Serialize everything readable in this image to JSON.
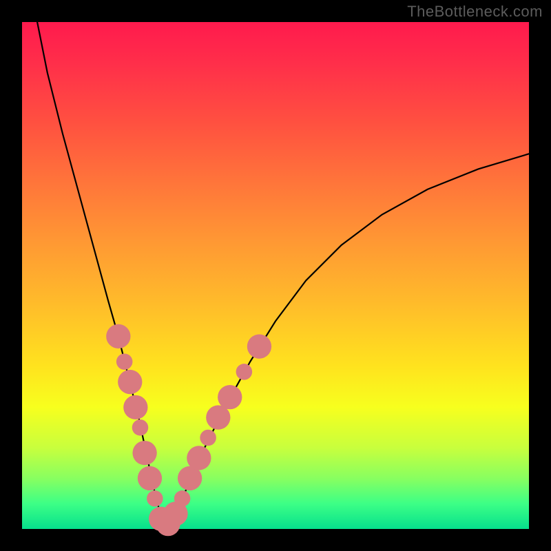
{
  "watermark": "TheBottleneck.com",
  "chart_data": {
    "type": "line",
    "title": "",
    "xlabel": "",
    "ylabel": "",
    "xlim": [
      0,
      100
    ],
    "ylim": [
      0,
      100
    ],
    "grid": false,
    "legend": false,
    "background_gradient": {
      "direction": "vertical",
      "stops": [
        {
          "pos": 0,
          "color": "#ff1a4d"
        },
        {
          "pos": 20,
          "color": "#ff5140"
        },
        {
          "pos": 44,
          "color": "#ff9a33"
        },
        {
          "pos": 68,
          "color": "#ffe31e"
        },
        {
          "pos": 84,
          "color": "#c8ff3d"
        },
        {
          "pos": 100,
          "color": "#06e08c"
        }
      ]
    },
    "series": [
      {
        "name": "bottleneck-curve",
        "color": "#000000",
        "x": [
          3,
          5,
          8,
          11,
          14,
          17,
          19,
          21,
          23,
          24.5,
          26,
          27,
          28,
          29,
          30,
          33,
          36,
          40,
          45,
          50,
          56,
          63,
          71,
          80,
          90,
          100
        ],
        "y": [
          100,
          90,
          78,
          67,
          56,
          45,
          38,
          30,
          22,
          15,
          8,
          4,
          1,
          1,
          3,
          9,
          16,
          24,
          33,
          41,
          49,
          56,
          62,
          67,
          71,
          74
        ]
      }
    ],
    "markers": {
      "name": "highlighted-points",
      "color": "#d97a80",
      "radius_major": 2.4,
      "radius_minor": 1.6,
      "points": [
        {
          "x": 19.0,
          "y": 38,
          "r": "major"
        },
        {
          "x": 20.2,
          "y": 33,
          "r": "minor"
        },
        {
          "x": 21.3,
          "y": 29,
          "r": "major"
        },
        {
          "x": 22.4,
          "y": 24,
          "r": "major"
        },
        {
          "x": 23.3,
          "y": 20,
          "r": "minor"
        },
        {
          "x": 24.2,
          "y": 15,
          "r": "major"
        },
        {
          "x": 25.2,
          "y": 10,
          "r": "major"
        },
        {
          "x": 26.2,
          "y": 6,
          "r": "minor"
        },
        {
          "x": 27.4,
          "y": 2,
          "r": "major"
        },
        {
          "x": 28.8,
          "y": 1,
          "r": "major"
        },
        {
          "x": 30.3,
          "y": 3,
          "r": "major"
        },
        {
          "x": 31.6,
          "y": 6,
          "r": "minor"
        },
        {
          "x": 33.1,
          "y": 10,
          "r": "major"
        },
        {
          "x": 34.9,
          "y": 14,
          "r": "major"
        },
        {
          "x": 36.7,
          "y": 18,
          "r": "minor"
        },
        {
          "x": 38.7,
          "y": 22,
          "r": "major"
        },
        {
          "x": 41.0,
          "y": 26,
          "r": "major"
        },
        {
          "x": 43.8,
          "y": 31,
          "r": "minor"
        },
        {
          "x": 46.8,
          "y": 36,
          "r": "major"
        }
      ]
    }
  }
}
